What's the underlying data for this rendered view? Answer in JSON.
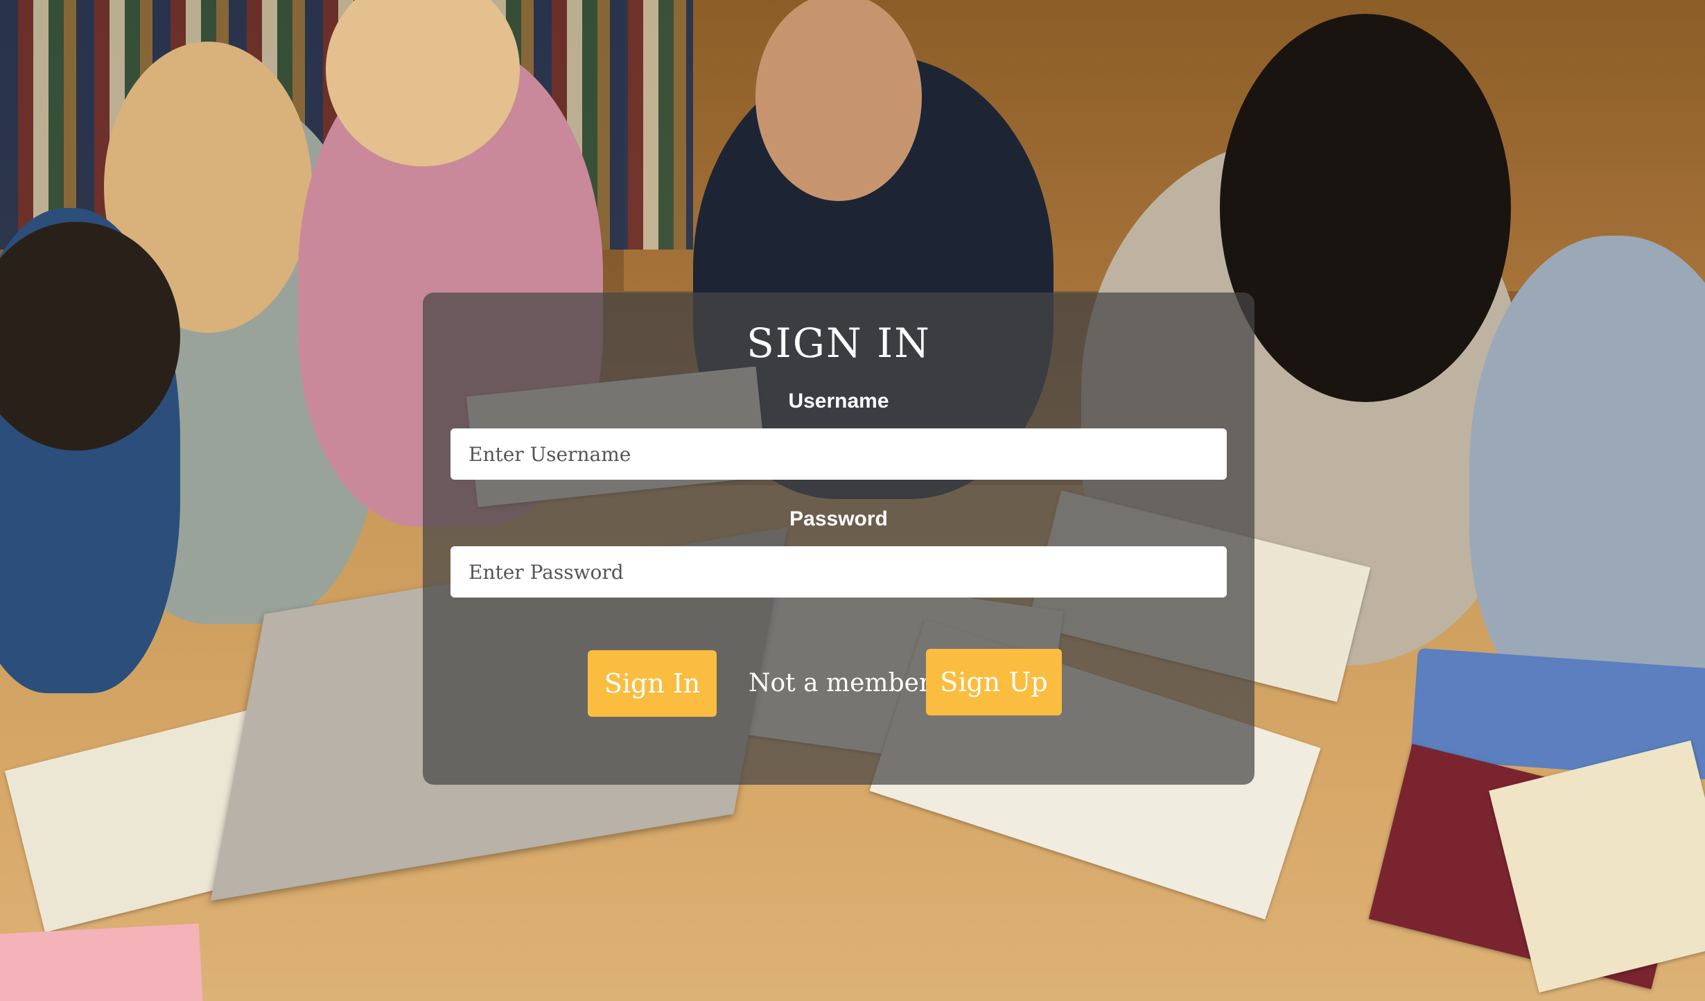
{
  "signin": {
    "title": "SIGN IN",
    "username_label": "Username",
    "username_placeholder": "Enter Username",
    "username_value": "",
    "password_label": "Password",
    "password_placeholder": "Enter Password",
    "password_value": "",
    "signin_button": "Sign In",
    "not_member_text": "Not a member?",
    "signup_button": "Sign Up"
  },
  "colors": {
    "button": "#fbbd3f",
    "card_overlay": "rgba(70,70,70,0.72)",
    "text": "#ffffff"
  }
}
